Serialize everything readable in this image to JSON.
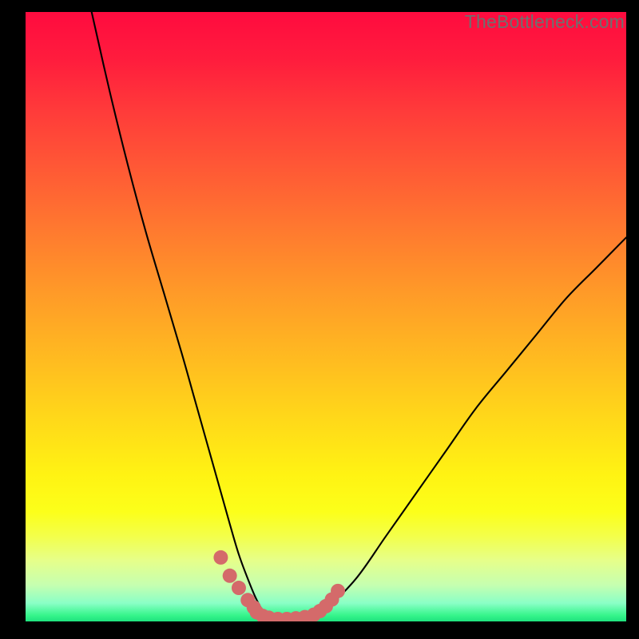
{
  "watermark": "TheBottleneck.com",
  "chart_data": {
    "type": "line",
    "title": "",
    "xlabel": "",
    "ylabel": "",
    "xlim": [
      0,
      100
    ],
    "ylim": [
      0,
      100
    ],
    "grid": false,
    "legend": false,
    "series": [
      {
        "name": "bottleneck-curve",
        "color": "#000000",
        "x": [
          11,
          14,
          17,
          20,
          23,
          26,
          28,
          30,
          32,
          34,
          35.5,
          37,
          38.5,
          40,
          42,
          45,
          48,
          50,
          55,
          60,
          65,
          70,
          75,
          80,
          85,
          90,
          95,
          100
        ],
        "y": [
          100,
          87,
          75,
          64,
          54,
          44,
          37,
          30,
          23,
          16,
          11,
          7,
          3.5,
          1.2,
          0.3,
          0.2,
          0.8,
          2.0,
          7,
          14,
          21,
          28,
          35,
          41,
          47,
          53,
          58,
          63
        ]
      }
    ],
    "markers": [
      {
        "name": "highlight-dots",
        "color": "#d46a6a",
        "x": [
          32.5,
          34,
          35.5,
          37,
          38,
          38.5,
          39.5,
          40.5,
          42,
          43.5,
          45,
          46.5,
          48,
          49,
          50,
          51,
          52
        ],
        "y": [
          10.5,
          7.5,
          5.5,
          3.5,
          2.3,
          1.5,
          0.9,
          0.6,
          0.4,
          0.4,
          0.5,
          0.7,
          1.1,
          1.7,
          2.5,
          3.6,
          5.0
        ]
      }
    ]
  }
}
